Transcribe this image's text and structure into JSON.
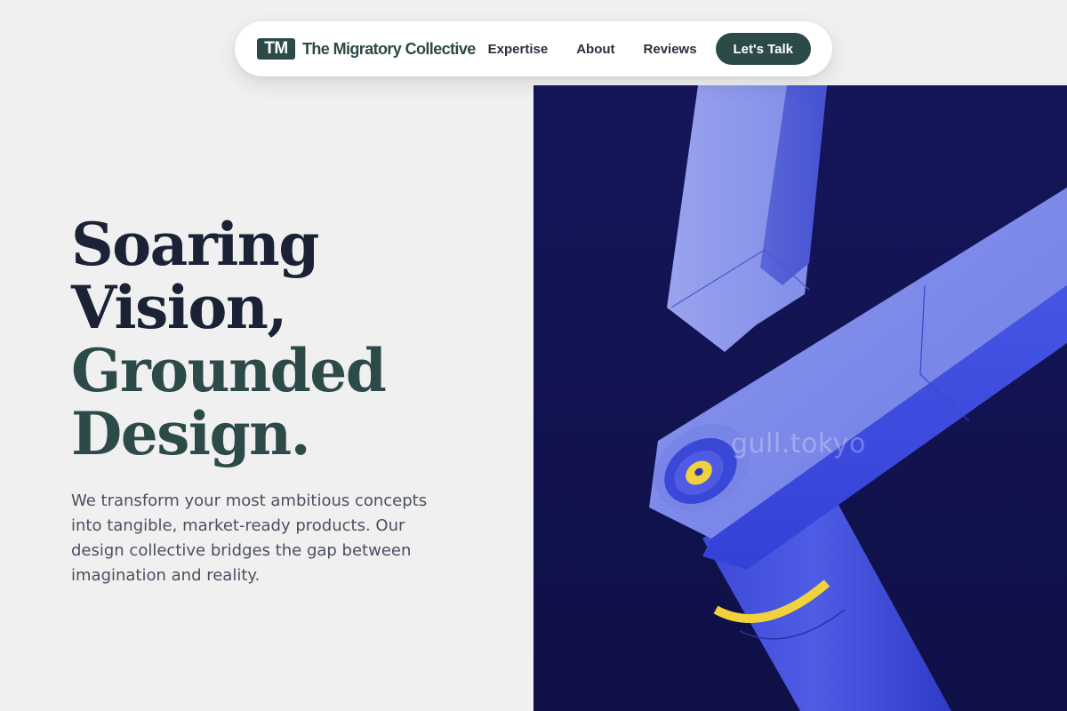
{
  "nav": {
    "logo_initials": "TM",
    "brand_name": "The Migratory Collective",
    "links": [
      "Expertise",
      "About",
      "Reviews"
    ],
    "cta_label": "Let's Talk"
  },
  "hero": {
    "title_line1": "Soaring",
    "title_line2": "Vision,",
    "title_line3": "Grounded",
    "title_line4": "Design.",
    "subtitle": "We transform your most ambitious concepts into tangible, market-ready products. Our design collective bridges the gap between imagination and reality."
  },
  "image": {
    "watermark": "gull.tokyo"
  },
  "colors": {
    "accent": "#2c4a48",
    "title_dark": "#1b2236",
    "art_background": "#12134f",
    "arm_light": "#8892ea",
    "arm_blue": "#3a4ae0",
    "joint_yellow": "#f0d23c"
  }
}
